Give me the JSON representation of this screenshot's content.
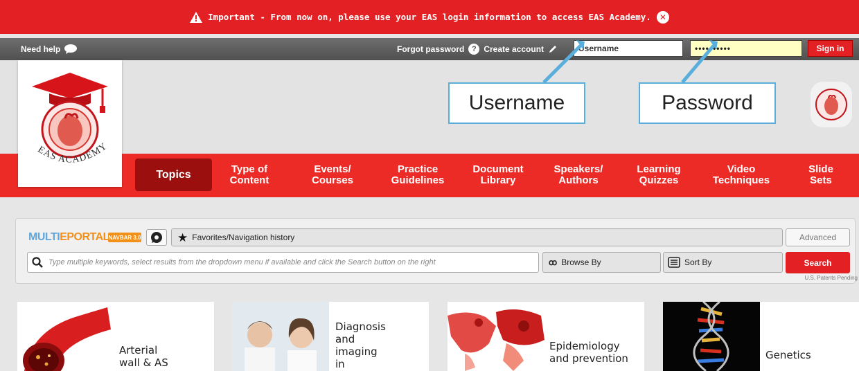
{
  "alert": {
    "text": "Important - From now on, please use your EAS login information to access EAS Academy.",
    "icon": "warning-icon",
    "close_icon": "close-icon"
  },
  "topbar": {
    "need_help": "Need help",
    "forgot_password": "Forgot password",
    "create_account": "Create account",
    "username_value": "Username",
    "password_value": "••••••••••",
    "sign_in": "Sign in"
  },
  "header": {
    "logo_text": "EAS ACADEMY"
  },
  "callouts": {
    "username": "Username",
    "password": "Password"
  },
  "nav": {
    "items": [
      {
        "label": "Topics"
      },
      {
        "label": "Type of\nContent"
      },
      {
        "label": "Events/\nCourses"
      },
      {
        "label": "Practice\nGuidelines"
      },
      {
        "label": "Document\nLibrary"
      },
      {
        "label": "Speakers/\nAuthors"
      },
      {
        "label": "Learning\nQuizzes"
      },
      {
        "label": "Video\nTechniques"
      },
      {
        "label": "Slide\nSets"
      }
    ]
  },
  "search": {
    "brand_multi": "MULTI",
    "brand_eportal": "EPORTAL",
    "navbar_badge": "NAVBAR 3.0",
    "favorites": "Favorites/Navigation history",
    "advanced": "Advanced",
    "placeholder": "Type multiple keywords, select results from the dropdown menu if available and click the Search button on the right",
    "browse_by": "Browse By",
    "sort_by": "Sort By",
    "search_button": "Search",
    "patent": "U.S. Patents Pending"
  },
  "cards": [
    {
      "label": "Arterial\nwall & AS"
    },
    {
      "label": "Diagnosis\nand\nimaging\nin"
    },
    {
      "label": "Epidemiology\nand prevention"
    },
    {
      "label": "Genetics"
    }
  ],
  "colors": {
    "brand_red": "#e32124",
    "nav_red": "#ed2b26",
    "topics_active": "#9b0f0f",
    "callout_blue": "#5aaedb",
    "multi_blue": "#63a6d9",
    "eportal_orange": "#f29018"
  }
}
